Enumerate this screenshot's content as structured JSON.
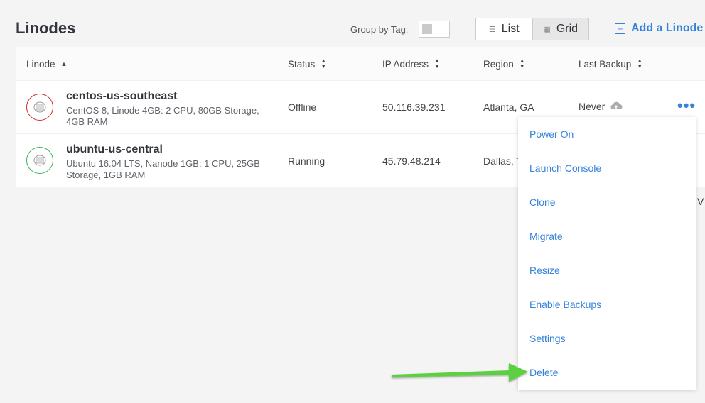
{
  "header": {
    "title": "Linodes",
    "group_by_tag_label": "Group by Tag:",
    "view_list_label": "List",
    "view_grid_label": "Grid",
    "add_label": "Add a Linode"
  },
  "table": {
    "columns": {
      "linode": "Linode",
      "status": "Status",
      "ip": "IP Address",
      "region": "Region",
      "backup": "Last Backup"
    },
    "rows": [
      {
        "name": "centos-us-southeast",
        "desc": "CentOS 8, Linode 4GB: 2 CPU, 80GB Storage, 4GB RAM",
        "status": "Offline",
        "ip": "50.116.39.231",
        "region": "Atlanta, GA",
        "backup": "Never"
      },
      {
        "name": "ubuntu-us-central",
        "desc": "Ubuntu 16.04 LTS, Nanode 1GB: 1 CPU, 25GB Storage, 1GB RAM",
        "status": "Running",
        "ip": "45.79.48.214",
        "region": "Dallas, T"
      }
    ]
  },
  "menu": {
    "items": [
      "Power On",
      "Launch Console",
      "Clone",
      "Migrate",
      "Resize",
      "Enable Backups",
      "Settings",
      "Delete"
    ]
  },
  "stray_text": "V",
  "colors": {
    "accent": "#3683dc",
    "offline": "#d02e2e",
    "running": "#3bb360",
    "arrow": "#5bd13f"
  }
}
